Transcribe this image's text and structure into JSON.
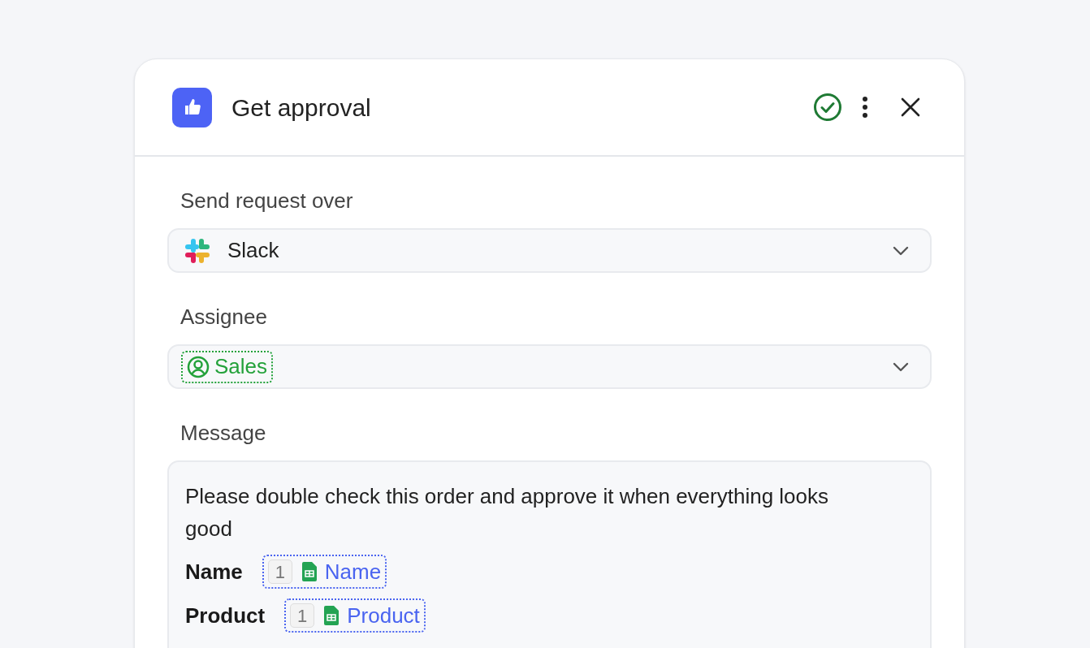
{
  "panel": {
    "title": "Get approval"
  },
  "fields": [
    {
      "kind": "select",
      "label": "Send request over",
      "value": "Slack"
    },
    {
      "kind": "token",
      "label": "Assignee",
      "value": "Sales"
    }
  ],
  "message": {
    "label": "Message",
    "text": "Please double check this order and approve it when everything looks good",
    "variables": [
      {
        "label": "Name",
        "step": "1",
        "field": "Name"
      },
      {
        "label": "Product",
        "step": "1",
        "field": "Product"
      }
    ]
  }
}
